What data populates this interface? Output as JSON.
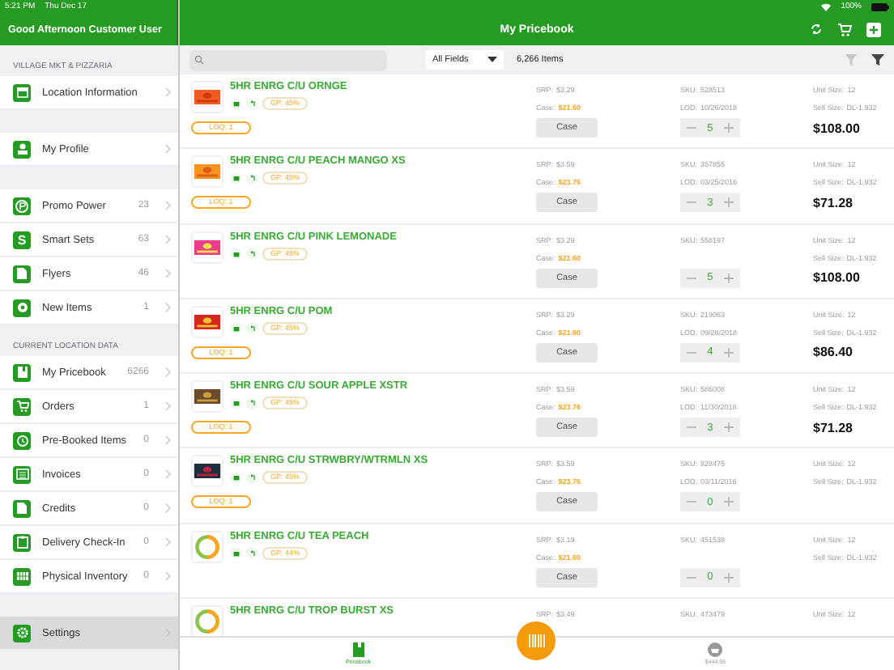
{
  "status_bar": {
    "time": "5:21 PM",
    "date": "Thu Dec 17",
    "battery": "100%"
  },
  "sidebar": {
    "title": "Good Afternoon Customer User",
    "groups": [
      {
        "header": "VILLAGE MKT & PIZZARIA",
        "items": [
          {
            "kind": "store",
            "label": "Location Information",
            "selected": false
          }
        ]
      },
      {
        "items": [
          {
            "kind": "person",
            "label": "My Profile",
            "selected": false
          }
        ]
      },
      {
        "items": [
          {
            "kind": "promo",
            "label": "Promo Power",
            "count": "23",
            "selected": false
          },
          {
            "kind": "letter",
            "label": "Smart Sets",
            "count": "63",
            "icon_text": "S",
            "selected": false
          },
          {
            "kind": "doc",
            "label": "Flyers",
            "count": "46",
            "selected": false
          },
          {
            "kind": "star",
            "label": "New Items",
            "count": "1",
            "selected": false
          }
        ]
      },
      {
        "header": "CURRENT LOCATION DATA",
        "items": [
          {
            "kind": "book",
            "label": "My Pricebook",
            "count": "6266",
            "selected": false
          },
          {
            "kind": "cart",
            "label": "Orders",
            "count": "1",
            "selected": false
          },
          {
            "kind": "clock",
            "label": "Pre-Booked Items",
            "count": "0",
            "selected": false
          },
          {
            "kind": "list",
            "label": "Invoices",
            "count": "0",
            "selected": false
          },
          {
            "kind": "doc",
            "label": "Credits",
            "count": "0",
            "selected": false
          },
          {
            "kind": "clip",
            "label": "Delivery Check-In",
            "count": "0",
            "selected": false
          },
          {
            "kind": "grid",
            "label": "Physical Inventory",
            "count": "0",
            "selected": false
          }
        ]
      },
      {
        "items": [
          {
            "kind": "gear",
            "label": "Settings",
            "selected": true
          }
        ]
      }
    ]
  },
  "header": {
    "title": "My Pricebook"
  },
  "toolbar": {
    "filter_field": "All Fields",
    "item_count": "6,266 Items",
    "clear_filter_disabled": true
  },
  "rows": [
    {
      "name": "5HR ENRG C/U ORNGE",
      "gp": "GP: 45%",
      "loq": "LOQ: 1",
      "srp_label": "SRP:",
      "srp": "$3.29",
      "case_label": "Case:",
      "case_price": "$21.60",
      "sku_label": "SKU:",
      "sku": "528513",
      "lod_label": "LOD:",
      "lod": "10/26/2018",
      "unit_label": "Unit Size:",
      "unit_size": "12",
      "sell_label": "Sell Size:",
      "sell_size": "DL-1.932",
      "button": "Case",
      "qty": "5",
      "total": "$108.00"
    },
    {
      "name": "5HR ENRG C/U PEACH MANGO XS",
      "gp": "GP: 45%",
      "loq": "LOQ: 1",
      "srp_label": "SRP:",
      "srp": "$3.59",
      "case_label": "Case:",
      "case_price": "$23.76",
      "sku_label": "SKU:",
      "sku": "357855",
      "lod_label": "LOD:",
      "lod": "03/25/2016",
      "unit_label": "Unit Size:",
      "unit_size": "12",
      "sell_label": "Sell Size:",
      "sell_size": "DL-1.932",
      "button": "Case",
      "qty": "3",
      "total": "$71.28"
    },
    {
      "name": "5HR ENRG C/U PINK LEMONADE",
      "gp": "GP: 45%",
      "srp_label": "SRP:",
      "srp": "$3.29",
      "case_label": "Case:",
      "case_price": "$21.60",
      "sku_label": "SKU:",
      "sku": "558197",
      "unit_label": "Unit Size:",
      "unit_size": "12",
      "sell_label": "Sell Size:",
      "sell_size": "DL-1.932",
      "button": "Case",
      "qty": "5",
      "total": "$108.00"
    },
    {
      "name": "5HR ENRG C/U POM",
      "gp": "GP: 45%",
      "loq": "LOQ: 1",
      "srp_label": "SRP:",
      "srp": "$3.29",
      "case_label": "Case:",
      "case_price": "$21.60",
      "sku_label": "SKU:",
      "sku": "219063",
      "lod_label": "LOD:",
      "lod": "09/28/2018",
      "unit_label": "Unit Size:",
      "unit_size": "12",
      "sell_label": "Sell Size:",
      "sell_size": "DL-1.932",
      "button": "Case",
      "qty": "4",
      "total": "$86.40"
    },
    {
      "name": "5HR ENRG C/U SOUR APPLE XSTR",
      "gp": "GP: 45%",
      "loq": "LOQ: 1",
      "srp_label": "SRP:",
      "srp": "$3.59",
      "case_label": "Case:",
      "case_price": "$23.76",
      "sku_label": "SKU:",
      "sku": "586008",
      "lod_label": "LOD:",
      "lod": "11/30/2018",
      "unit_label": "Unit Size:",
      "unit_size": "12",
      "sell_label": "Sell Size:",
      "sell_size": "DL-1.932",
      "button": "Case",
      "qty": "3",
      "total": "$71.28"
    },
    {
      "name": "5HR ENRG C/U STRWBRY/WTRMLN XS",
      "gp": "GP: 45%",
      "loq": "LOQ: 1",
      "srp_label": "SRP:",
      "srp": "$3.59",
      "case_label": "Case:",
      "case_price": "$23.76",
      "sku_label": "SKU:",
      "sku": "828475",
      "lod_label": "LOD:",
      "lod": "03/11/2016",
      "unit_label": "Unit Size:",
      "unit_size": "12",
      "sell_label": "Sell Size:",
      "sell_size": "DL-1.932",
      "button": "Case",
      "qty": "0"
    },
    {
      "name": "5HR ENRG C/U TEA PEACH",
      "gp": "GP: 44%",
      "srp_label": "SRP:",
      "srp": "$3.19",
      "case_label": "Case:",
      "case_price": "$21.60",
      "sku_label": "SKU:",
      "sku": "451538",
      "unit_label": "Unit Size:",
      "unit_size": "12",
      "sell_label": "Sell Size:",
      "sell_size": "DL-1.932",
      "button": "Case",
      "qty": "0"
    },
    {
      "name": "5HR ENRG C/U TROP BURST XS",
      "srp_label": "SRP:",
      "srp": "$3.49",
      "sku_label": "SKU:",
      "sku": "473479",
      "unit_label": "Unit Size:",
      "unit_size": "12"
    }
  ],
  "tab_bar": {
    "tabs": [
      {
        "kind": "book",
        "label": "Pricebook",
        "selected": true
      },
      {
        "kind": "basket",
        "label": "$444.96",
        "selected": false
      }
    ]
  }
}
